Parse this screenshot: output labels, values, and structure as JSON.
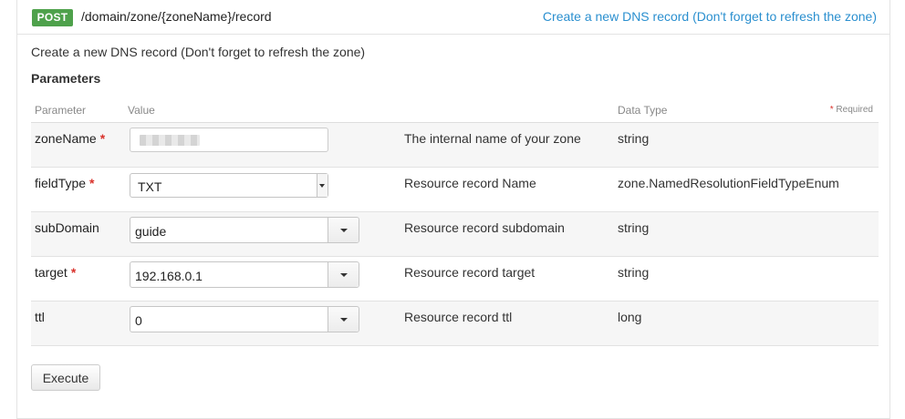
{
  "operation": {
    "method": "POST",
    "path": "/domain/zone/{zoneName}/record",
    "summary_link": "Create a new DNS record (Don't forget to refresh the zone)",
    "description": "Create a new DNS record (Don't forget to refresh the zone)"
  },
  "parameters": {
    "heading": "Parameters",
    "columns": {
      "parameter": "Parameter",
      "value": "Value",
      "data_type": "Data Type",
      "required_note": "Required",
      "required_marker": "*"
    },
    "rows": [
      {
        "name": "zoneName",
        "required": "*",
        "value": "",
        "description": "The internal name of your zone",
        "type": "string"
      },
      {
        "name": "fieldType",
        "required": "*",
        "value": "TXT",
        "description": "Resource record Name",
        "type": "zone.NamedResolutionFieldTypeEnum"
      },
      {
        "name": "subDomain",
        "required": "",
        "value": "guide",
        "description": "Resource record subdomain",
        "type": "string"
      },
      {
        "name": "target",
        "required": "*",
        "value": "192.168.0.1",
        "description": "Resource record target",
        "type": "string"
      },
      {
        "name": "ttl",
        "required": "",
        "value": "0",
        "description": "Resource record ttl",
        "type": "long"
      }
    ]
  },
  "actions": {
    "execute_label": "Execute"
  },
  "colors": {
    "method_badge": "#4ea14b",
    "link": "#2a8fcf",
    "required_star": "#d9322b"
  }
}
